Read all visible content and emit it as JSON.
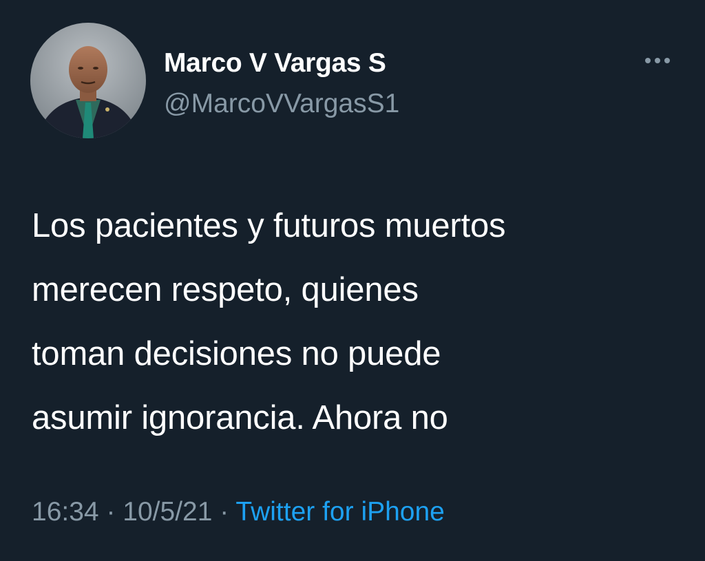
{
  "author": {
    "display_name": "Marco V Vargas S",
    "handle": "@MarcoVVargasS1"
  },
  "tweet": {
    "text": "Los pacientes y futuros muertos\nmerecen respeto,  quienes\ntoman decisiones no puede\nasumir ignorancia. Ahora no",
    "time": "16:34",
    "separator": "·",
    "date": "10/5/21",
    "source": "Twitter for iPhone"
  },
  "icons": {
    "more": "more-horizontal-icon",
    "avatar": "profile-photo"
  },
  "colors": {
    "background": "#15202b",
    "primary_text": "#ffffff",
    "secondary_text": "#8899a6",
    "link": "#1da1f2"
  }
}
